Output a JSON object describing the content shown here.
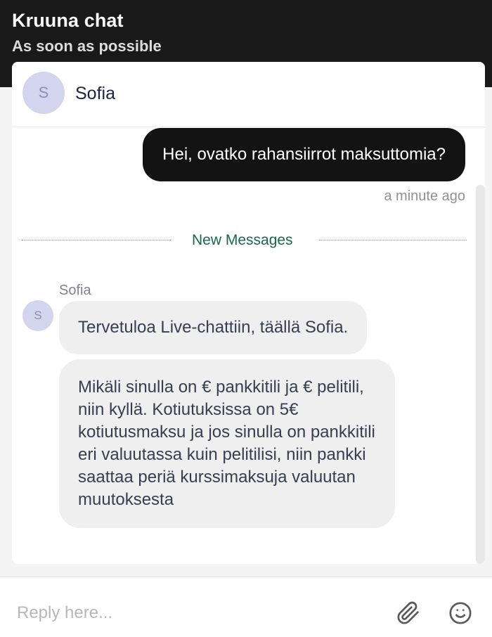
{
  "header": {
    "title": "Kruuna chat",
    "subtitle": "As soon as possible"
  },
  "agent": {
    "initial": "S",
    "name": "Sofia"
  },
  "messages": {
    "outgoing": [
      {
        "text": "Hei, ovatko rahansiirrot maksuttomia?",
        "time": "a minute ago"
      }
    ],
    "divider": "New Messages",
    "incoming_sender": "Sofia",
    "incoming_initial": "S",
    "incoming": [
      {
        "text": "Tervetuloa Live-chattiin, täällä Sofia."
      },
      {
        "text": "Mikäli sinulla on € pankkitili ja € pelitili, niin kyllä. Kotiutuksissa on 5€ kotiutusmaksu ja jos sinulla on pankkitili eri valuutassa kuin pelitilisi, niin pankki saattaa periä kurssimaksuja valuutan muutoksesta"
      }
    ]
  },
  "composer": {
    "placeholder": "Reply here...",
    "attach_icon": "paperclip-icon",
    "emoji_icon": "smiley-icon"
  },
  "colors": {
    "header_bg": "#191919",
    "outgoing_bubble": "#131313",
    "incoming_bubble": "#efefef",
    "divider_text": "#146a4a",
    "avatar_bg": "#d3d5ee"
  }
}
